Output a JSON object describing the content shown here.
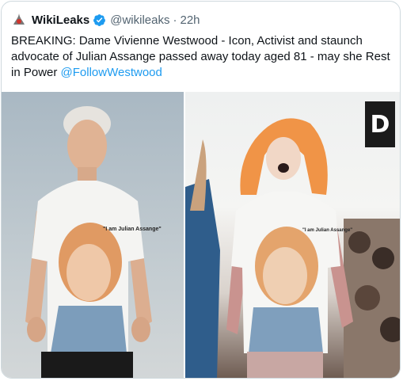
{
  "tweet": {
    "author_name": "WikiLeaks",
    "handle": "@wikileaks",
    "separator": "·",
    "time": "22h",
    "text_main": "BREAKING: Dame Vivienne Westwood - Icon, Activist and staunch advocate of Julian Assange passed away today aged 81 - may she Rest in Power ",
    "mention": "@FollowWestwood"
  },
  "media": {
    "left_shirt_text": "\"I am Julian Assange\"",
    "right_shirt_text": "\"I am Julian Assange\"",
    "sign_letter": "D"
  },
  "colors": {
    "link": "#1d9bf0",
    "verified": "#1d9bf0",
    "text": "#0f1419",
    "muted": "#536471"
  }
}
